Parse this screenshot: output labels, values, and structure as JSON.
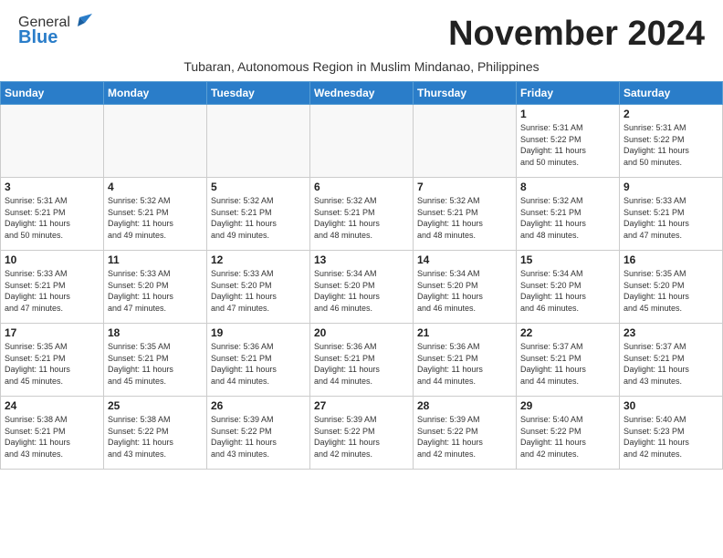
{
  "header": {
    "logo_general": "General",
    "logo_blue": "Blue",
    "month_title": "November 2024",
    "subtitle": "Tubaran, Autonomous Region in Muslim Mindanao, Philippines"
  },
  "days_of_week": [
    "Sunday",
    "Monday",
    "Tuesday",
    "Wednesday",
    "Thursday",
    "Friday",
    "Saturday"
  ],
  "weeks": [
    [
      {
        "day": "",
        "info": ""
      },
      {
        "day": "",
        "info": ""
      },
      {
        "day": "",
        "info": ""
      },
      {
        "day": "",
        "info": ""
      },
      {
        "day": "",
        "info": ""
      },
      {
        "day": "1",
        "info": "Sunrise: 5:31 AM\nSunset: 5:22 PM\nDaylight: 11 hours\nand 50 minutes."
      },
      {
        "day": "2",
        "info": "Sunrise: 5:31 AM\nSunset: 5:22 PM\nDaylight: 11 hours\nand 50 minutes."
      }
    ],
    [
      {
        "day": "3",
        "info": "Sunrise: 5:31 AM\nSunset: 5:21 PM\nDaylight: 11 hours\nand 50 minutes."
      },
      {
        "day": "4",
        "info": "Sunrise: 5:32 AM\nSunset: 5:21 PM\nDaylight: 11 hours\nand 49 minutes."
      },
      {
        "day": "5",
        "info": "Sunrise: 5:32 AM\nSunset: 5:21 PM\nDaylight: 11 hours\nand 49 minutes."
      },
      {
        "day": "6",
        "info": "Sunrise: 5:32 AM\nSunset: 5:21 PM\nDaylight: 11 hours\nand 48 minutes."
      },
      {
        "day": "7",
        "info": "Sunrise: 5:32 AM\nSunset: 5:21 PM\nDaylight: 11 hours\nand 48 minutes."
      },
      {
        "day": "8",
        "info": "Sunrise: 5:32 AM\nSunset: 5:21 PM\nDaylight: 11 hours\nand 48 minutes."
      },
      {
        "day": "9",
        "info": "Sunrise: 5:33 AM\nSunset: 5:21 PM\nDaylight: 11 hours\nand 47 minutes."
      }
    ],
    [
      {
        "day": "10",
        "info": "Sunrise: 5:33 AM\nSunset: 5:21 PM\nDaylight: 11 hours\nand 47 minutes."
      },
      {
        "day": "11",
        "info": "Sunrise: 5:33 AM\nSunset: 5:20 PM\nDaylight: 11 hours\nand 47 minutes."
      },
      {
        "day": "12",
        "info": "Sunrise: 5:33 AM\nSunset: 5:20 PM\nDaylight: 11 hours\nand 47 minutes."
      },
      {
        "day": "13",
        "info": "Sunrise: 5:34 AM\nSunset: 5:20 PM\nDaylight: 11 hours\nand 46 minutes."
      },
      {
        "day": "14",
        "info": "Sunrise: 5:34 AM\nSunset: 5:20 PM\nDaylight: 11 hours\nand 46 minutes."
      },
      {
        "day": "15",
        "info": "Sunrise: 5:34 AM\nSunset: 5:20 PM\nDaylight: 11 hours\nand 46 minutes."
      },
      {
        "day": "16",
        "info": "Sunrise: 5:35 AM\nSunset: 5:20 PM\nDaylight: 11 hours\nand 45 minutes."
      }
    ],
    [
      {
        "day": "17",
        "info": "Sunrise: 5:35 AM\nSunset: 5:21 PM\nDaylight: 11 hours\nand 45 minutes."
      },
      {
        "day": "18",
        "info": "Sunrise: 5:35 AM\nSunset: 5:21 PM\nDaylight: 11 hours\nand 45 minutes."
      },
      {
        "day": "19",
        "info": "Sunrise: 5:36 AM\nSunset: 5:21 PM\nDaylight: 11 hours\nand 44 minutes."
      },
      {
        "day": "20",
        "info": "Sunrise: 5:36 AM\nSunset: 5:21 PM\nDaylight: 11 hours\nand 44 minutes."
      },
      {
        "day": "21",
        "info": "Sunrise: 5:36 AM\nSunset: 5:21 PM\nDaylight: 11 hours\nand 44 minutes."
      },
      {
        "day": "22",
        "info": "Sunrise: 5:37 AM\nSunset: 5:21 PM\nDaylight: 11 hours\nand 44 minutes."
      },
      {
        "day": "23",
        "info": "Sunrise: 5:37 AM\nSunset: 5:21 PM\nDaylight: 11 hours\nand 43 minutes."
      }
    ],
    [
      {
        "day": "24",
        "info": "Sunrise: 5:38 AM\nSunset: 5:21 PM\nDaylight: 11 hours\nand 43 minutes."
      },
      {
        "day": "25",
        "info": "Sunrise: 5:38 AM\nSunset: 5:22 PM\nDaylight: 11 hours\nand 43 minutes."
      },
      {
        "day": "26",
        "info": "Sunrise: 5:39 AM\nSunset: 5:22 PM\nDaylight: 11 hours\nand 43 minutes."
      },
      {
        "day": "27",
        "info": "Sunrise: 5:39 AM\nSunset: 5:22 PM\nDaylight: 11 hours\nand 42 minutes."
      },
      {
        "day": "28",
        "info": "Sunrise: 5:39 AM\nSunset: 5:22 PM\nDaylight: 11 hours\nand 42 minutes."
      },
      {
        "day": "29",
        "info": "Sunrise: 5:40 AM\nSunset: 5:22 PM\nDaylight: 11 hours\nand 42 minutes."
      },
      {
        "day": "30",
        "info": "Sunrise: 5:40 AM\nSunset: 5:23 PM\nDaylight: 11 hours\nand 42 minutes."
      }
    ]
  ]
}
